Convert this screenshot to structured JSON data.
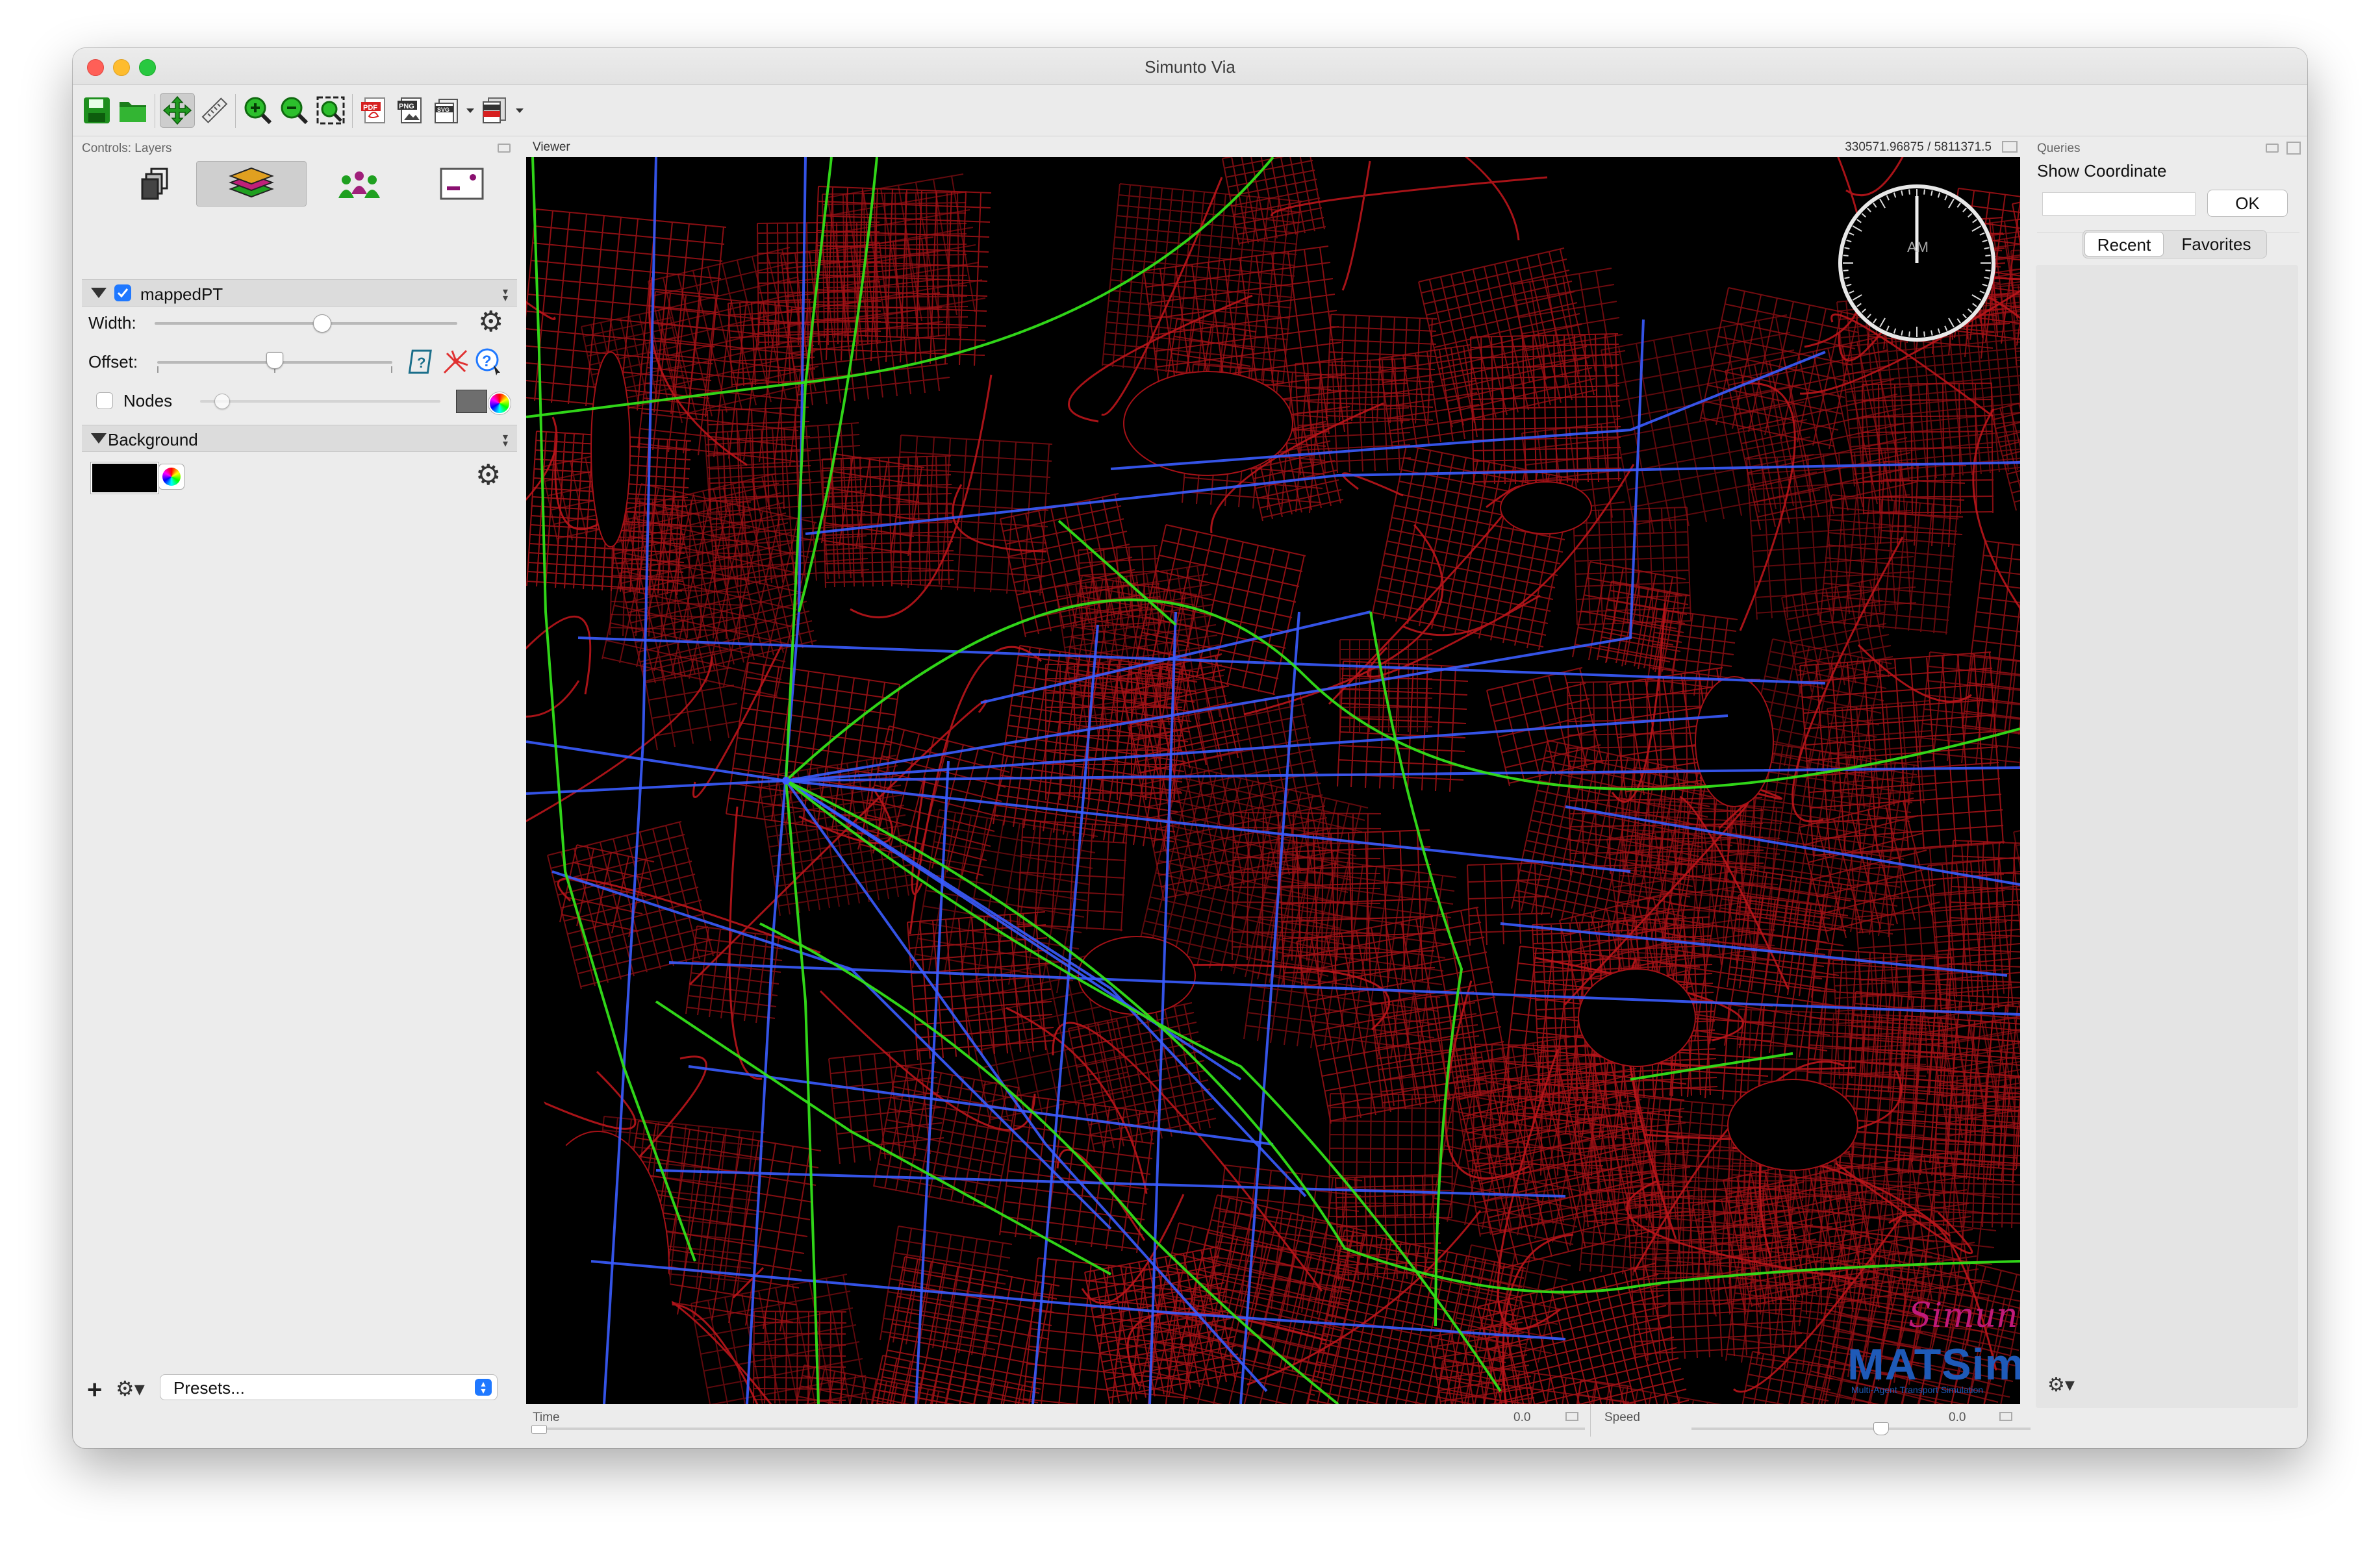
{
  "window": {
    "title": "Simunto Via"
  },
  "colors": {
    "map_background": "#000000",
    "roads": "#c0141a",
    "pt_bus": "#3a5cff",
    "pt_rail": "#33e019",
    "accent": "#1f78ff"
  },
  "toolbar": {
    "icons": [
      "save-icon",
      "open-folder-icon",
      "pan-move-icon",
      "measure-ruler-icon",
      "zoom-in-icon",
      "zoom-out-icon",
      "zoom-to-fit-icon",
      "export-pdf-icon",
      "export-png-icon",
      "export-svg-icon",
      "export-png-pdf-icon"
    ]
  },
  "controls": {
    "panel_title": "Controls: Layers",
    "tabs": [
      "data-sources-tab",
      "layers-tab",
      "agents-tab",
      "legend-tab"
    ],
    "layer": {
      "name": "mappedPT",
      "checked": true,
      "width_label": "Width:",
      "width_value": 0.37,
      "offset_label": "Offset:",
      "offset_value": 0.5,
      "nodes_label": "Nodes",
      "nodes_checked": false
    },
    "background": {
      "name": "Background",
      "color": "#000000"
    },
    "presets_label": "Presets..."
  },
  "viewer": {
    "panel_title": "Viewer",
    "coordinates": "330571.96875 / 5811371.5",
    "clock_label": "AM",
    "logo_simunto": "Simunto",
    "logo_matsim": "MATSim",
    "logo_matsim_sub": "Multi-Agent Transport Simulation"
  },
  "time": {
    "label": "Time",
    "value": "0.0"
  },
  "speed": {
    "label": "Speed",
    "value": "0.0"
  },
  "queries": {
    "panel_title": "Queries",
    "show_coordinate": "Show Coordinate",
    "input_value": "",
    "ok_label": "OK",
    "tabs": [
      "Recent",
      "Favorites"
    ],
    "active_tab": "Recent"
  }
}
